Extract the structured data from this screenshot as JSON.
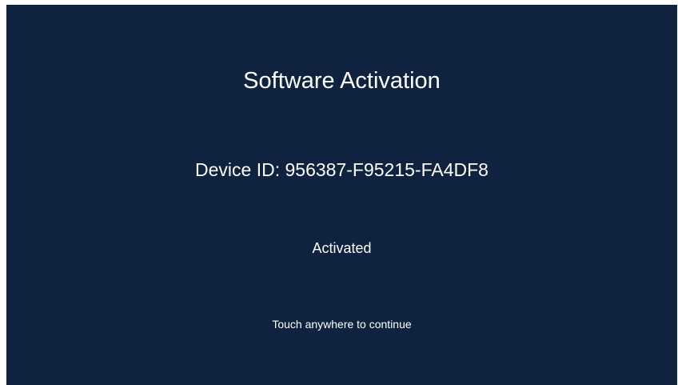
{
  "activation": {
    "title": "Software Activation",
    "device_id_line": "Device ID: 956387-F95215-FA4DF8",
    "status": "Activated",
    "hint": "Touch anywhere to continue"
  },
  "colors": {
    "background": "#0f2340",
    "text": "#ffffff"
  }
}
